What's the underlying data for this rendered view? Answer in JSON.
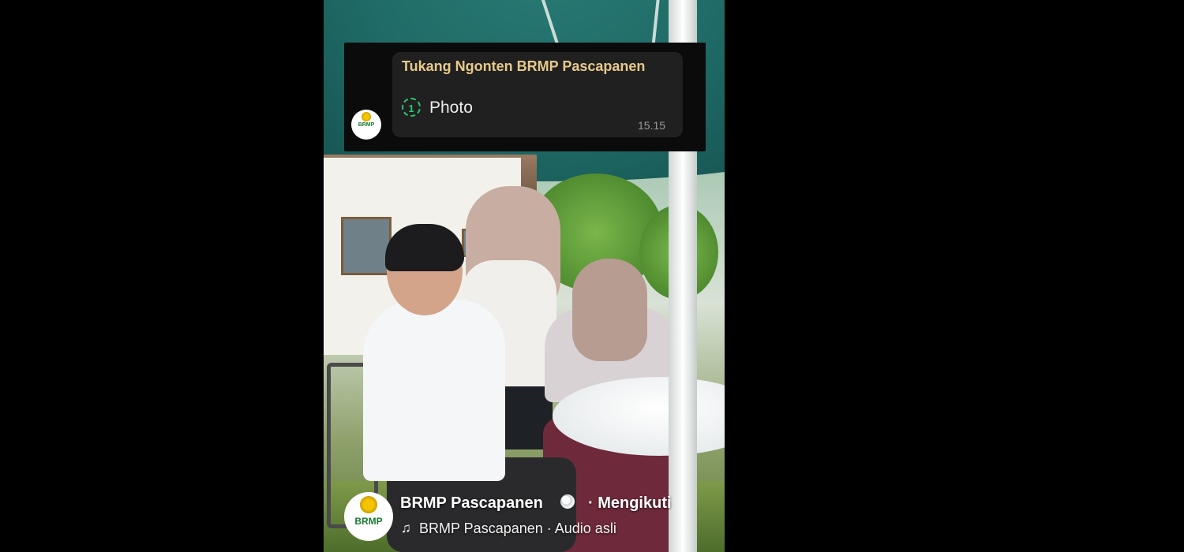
{
  "notification": {
    "sender": "Tukang Ngonten BRMP Pascapanen",
    "view_once_marker": "1",
    "message": "Photo",
    "time": "15.15"
  },
  "logo": {
    "text": "BRMP"
  },
  "post": {
    "author": "BRMP Pascapanen",
    "follow_status": "· Mengikuti",
    "audio": "BRMP Pascapanen · Audio asli",
    "audience_icon": "globe-icon",
    "audio_icon": "music-note-icon"
  },
  "colors": {
    "sender_name": "#e7c98a",
    "view_once": "#28c76f",
    "background": "#000000"
  }
}
